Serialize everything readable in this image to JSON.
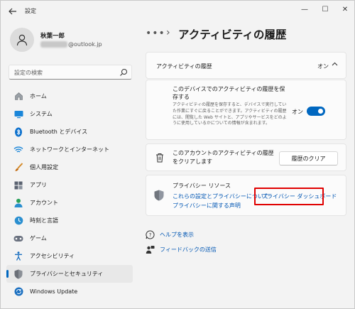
{
  "window": {
    "title": "設定",
    "controls": [
      "—",
      "☐",
      "✕"
    ]
  },
  "profile": {
    "name": "秋葉一郎",
    "email_suffix": "@outlook.jp"
  },
  "search": {
    "placeholder": "設定の検索"
  },
  "sidebar": {
    "items": [
      {
        "label": "ホーム",
        "icon": "home-icon"
      },
      {
        "label": "システム",
        "icon": "system-icon"
      },
      {
        "label": "Bluetooth とデバイス",
        "icon": "bluetooth-icon"
      },
      {
        "label": "ネットワークとインターネット",
        "icon": "wifi-icon"
      },
      {
        "label": "個人用設定",
        "icon": "brush-icon"
      },
      {
        "label": "アプリ",
        "icon": "apps-icon"
      },
      {
        "label": "アカウント",
        "icon": "account-icon"
      },
      {
        "label": "時刻と言語",
        "icon": "time-language-icon"
      },
      {
        "label": "ゲーム",
        "icon": "gamepad-icon"
      },
      {
        "label": "アクセシビリティ",
        "icon": "accessibility-icon"
      },
      {
        "label": "プライバシーとセキュリティ",
        "icon": "shield-icon"
      },
      {
        "label": "Windows Update",
        "icon": "windows-update-icon"
      }
    ],
    "active_index": 10
  },
  "breadcrumb": {
    "dots": "•••",
    "separator": "›",
    "title": "アクティビティの履歴"
  },
  "activity_header": {
    "label": "アクティビティの履歴",
    "state": "オン"
  },
  "save_setting": {
    "title": "このデバイスでのアクティビティの履歴を保存する",
    "description": "アクティビティの履歴を保存すると、デバイスで実行していた作業にすぐに戻ることができます。アクティビティの履歴には、閲覧した Web サイトと、アプリやサービスをどのように使用しているかについての情報が含まれます。",
    "state": "オン",
    "toggle_on": true
  },
  "clear_history": {
    "text": "このアカウントのアクティビティの履歴をクリアします",
    "button": "履歴のクリア"
  },
  "privacy_resources": {
    "title": "プライバシー リソース",
    "link1": "これらの設定とプライバシーについて",
    "link2": "プライバシー ダッシュボード",
    "link3": "プライバシーに関する声明"
  },
  "help": {
    "help_link": "ヘルプを表示",
    "feedback_link": "フィードバックの送信"
  },
  "colors": {
    "accent": "#0067c0",
    "link": "#0056b3",
    "highlight": "#e00000"
  }
}
